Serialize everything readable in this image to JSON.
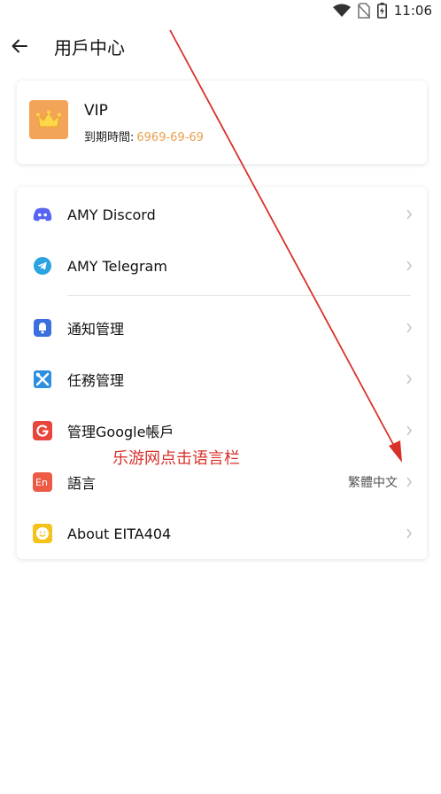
{
  "status_bar": {
    "time": "11:06"
  },
  "header": {
    "title": "用戶中心"
  },
  "vip": {
    "label": "VIP",
    "expiry_label": "到期時間:",
    "expiry_date": "6969-69-69"
  },
  "menu": {
    "discord": "AMY Discord",
    "telegram": "AMY Telegram",
    "notifications": "通知管理",
    "tasks": "任務管理",
    "google": "管理Google帳戶",
    "language": "語言",
    "language_value": "繁體中文",
    "about": "About EITA404"
  },
  "annotation": {
    "text": "乐游网点击语言栏"
  },
  "colors": {
    "accent_orange": "#f4a458",
    "date_orange": "#e8a04a",
    "annotation_red": "#d8312a",
    "discord_blue": "#5865f2",
    "telegram_blue": "#2aa3e0",
    "bell_blue": "#3b6fe0",
    "tools_blue": "#2d8fe0",
    "google_red": "#e8453c",
    "lang_red": "#ee5a45",
    "smile_yellow": "#f5c21b"
  }
}
